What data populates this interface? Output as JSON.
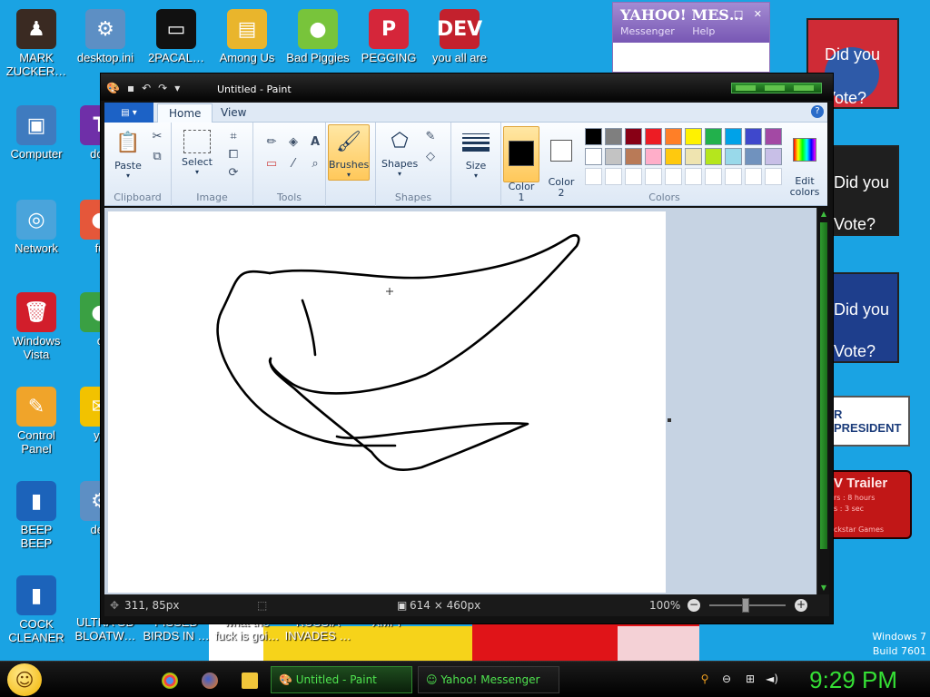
{
  "desktop": {
    "icons": [
      {
        "label": "MARK\nZUCKER…",
        "color": "#3a2a22",
        "glyph": "♟"
      },
      {
        "label": "desktop.ini",
        "color": "#5d8fc4",
        "glyph": "⚙"
      },
      {
        "label": "2PACAL…",
        "color": "#111111",
        "glyph": "▭"
      },
      {
        "label": "Among Us",
        "color": "#e9b52c",
        "glyph": "▤"
      },
      {
        "label": "Bad Piggies",
        "color": "#78c43b",
        "glyph": "●"
      },
      {
        "label": "PEGGING",
        "color": "#d5263a",
        "glyph": "P"
      },
      {
        "label": "you all are",
        "color": "#c3212d",
        "glyph": "DEV"
      },
      {
        "label": "Computer",
        "color": "#3f7bbf",
        "glyph": "▣"
      },
      {
        "label": "doe",
        "color": "#6f2fa8",
        "glyph": "T"
      },
      {
        "label": "Network",
        "color": "#4aa4db",
        "glyph": "◎"
      },
      {
        "label": "fu",
        "color": "#e5573a",
        "glyph": "●"
      },
      {
        "label": "Windows\nVista",
        "color": "#d21e2b",
        "glyph": "🗑"
      },
      {
        "label": "c",
        "color": "#3aa043",
        "glyph": "●"
      },
      {
        "label": "Control\nPanel",
        "color": "#f0a42a",
        "glyph": "✎"
      },
      {
        "label": "yo",
        "color": "#f2c200",
        "glyph": "✉"
      },
      {
        "label": "BEEP\nBEEP",
        "color": "#1c63ba",
        "glyph": "▮"
      },
      {
        "label": "des",
        "color": "#5d8fc4",
        "glyph": "⚙"
      },
      {
        "label": "COCK\nCLEANER",
        "color": "#1c63ba",
        "glyph": "▮"
      },
      {
        "label": "ULTRA GD\nBLOATW…",
        "color": "#1aa3e3",
        "glyph": ""
      },
      {
        "label": "PISSED\nBIRDS IN …",
        "color": "#1aa3e3",
        "glyph": ""
      },
      {
        "label": "what the\nfuck is goi…",
        "color": "#1aa3e3",
        "glyph": ""
      },
      {
        "label": "RUSSIA\nINVADES …",
        "color": "#1aa3e3",
        "glyph": ""
      },
      {
        "label": "XMPP",
        "color": "#1aa3e3",
        "glyph": ""
      }
    ],
    "windows_version": "Windows 7",
    "build": "Build 7601"
  },
  "yahoo": {
    "logo": "YAHOO! MES…",
    "menu": [
      "Messenger",
      "Help"
    ],
    "controls": "_ □ ✕"
  },
  "posters": {
    "p1": "Did you\nVote?",
    "p2": "Did you\nVote?",
    "p3": "Did you\nVote?",
    "president": "R PRESIDENT",
    "trailer_title": "V Trailer",
    "trailer_line1": "rs : 8 hours",
    "trailer_line2": "s : 3 sec",
    "trailer_footer": "ckstar Games"
  },
  "paint": {
    "title": "Untitled - Paint",
    "tabs": [
      "Home",
      "View"
    ],
    "clipboard": {
      "group": "Clipboard",
      "paste": "Paste"
    },
    "image": {
      "group": "Image",
      "select": "Select"
    },
    "tools": {
      "group": "Tools"
    },
    "brushes": {
      "label": "Brushes"
    },
    "shapes": {
      "group": "Shapes",
      "label": "Shapes"
    },
    "size": {
      "label": "Size"
    },
    "colors": {
      "group": "Colors",
      "color1": "Color\n1",
      "color2": "Color\n2",
      "edit": "Edit\ncolors",
      "color1_value": "#000000",
      "color2_value": "#ffffff",
      "row1": [
        "#000000",
        "#7f7f7f",
        "#880015",
        "#ed1c24",
        "#ff7f27",
        "#fff200",
        "#22b14c",
        "#00a2e8",
        "#3f48cc",
        "#a349a4"
      ],
      "row2": [
        "#ffffff",
        "#c3c3c3",
        "#b97a57",
        "#ffaec9",
        "#ffc90e",
        "#efe4b0",
        "#b5e61d",
        "#99d9ea",
        "#7092be",
        "#c8bfe7"
      ],
      "row3": [
        "#ffffff",
        "#ffffff",
        "#ffffff",
        "#ffffff",
        "#ffffff",
        "#ffffff",
        "#ffffff",
        "#ffffff",
        "#ffffff",
        "#ffffff"
      ]
    },
    "status": {
      "cursor": "311, 85px",
      "size": "614 × 460px",
      "zoom": "100%"
    }
  },
  "taskbar": {
    "items": [
      "Untitled - Paint",
      "Yahoo! Messenger"
    ],
    "clock": "9:29 PM"
  }
}
